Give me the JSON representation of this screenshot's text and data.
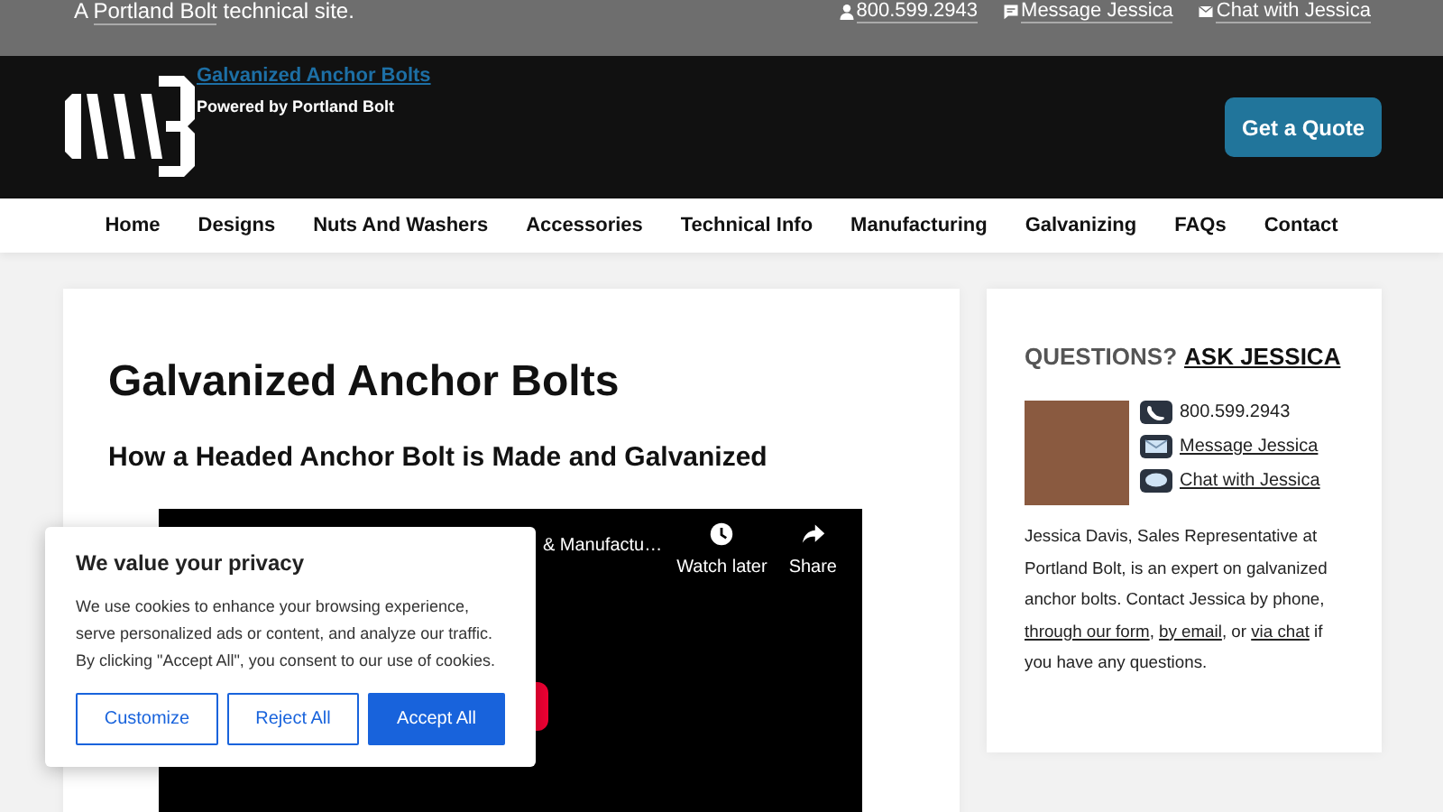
{
  "top_bar": {
    "tagline": [
      {
        "kind": "text",
        "text": "A "
      },
      {
        "kind": "link",
        "text": "Portland Bolt"
      },
      {
        "kind": "text",
        "text": " technical site."
      }
    ],
    "links": [
      "800.599.2943",
      "Message Jessica",
      "Chat with Jessica"
    ]
  },
  "header": {
    "site_title": "Galvanized Anchor Bolts",
    "subtitle": "Powered by Portland Bolt",
    "cta": "Get a Quote"
  },
  "nav": [
    "Home",
    "Designs",
    "Nuts And Washers",
    "Accessories",
    "Technical Info",
    "Manufacturing",
    "Galvanizing",
    "FAQs",
    "Contact"
  ],
  "main": {
    "title": "Galvanized Anchor Bolts",
    "subtitle": "How a Headed Anchor Bolt is Made and Galvanized",
    "video": {
      "title": "& Manufactu…",
      "actions": [
        "Watch later",
        "Share"
      ]
    }
  },
  "sidebar": {
    "heading": "QUESTIONS?",
    "heading_link": "ASK JESSICA",
    "contacts": [
      {
        "text": "800.599.2943",
        "link": false
      },
      {
        "text": "Message Jessica",
        "link": true
      },
      {
        "text": "Chat with Jessica",
        "link": true
      }
    ],
    "bio": [
      {
        "kind": "text",
        "text": "Jessica Davis, Sales Representative at Portland Bolt, is an expert on galvanized anchor bolts. Contact Jessica by phone, "
      },
      {
        "kind": "link",
        "text": "through our form"
      },
      {
        "kind": "text",
        "text": ", "
      },
      {
        "kind": "link",
        "text": "by email"
      },
      {
        "kind": "text",
        "text": ", or "
      },
      {
        "kind": "link",
        "text": "via chat"
      },
      {
        "kind": "text",
        "text": " if you have any questions."
      }
    ]
  },
  "cookie": {
    "title": "We value your privacy",
    "text": "We use cookies to enhance your browsing experience, serve personalized ads or content, and analyze our traffic. By clicking \"Accept All\", you consent to our use of cookies.",
    "buttons": [
      {
        "label": "Customize",
        "kind": "outline"
      },
      {
        "label": "Reject All",
        "kind": "outline"
      },
      {
        "label": "Accept All",
        "kind": "primary"
      }
    ]
  }
}
